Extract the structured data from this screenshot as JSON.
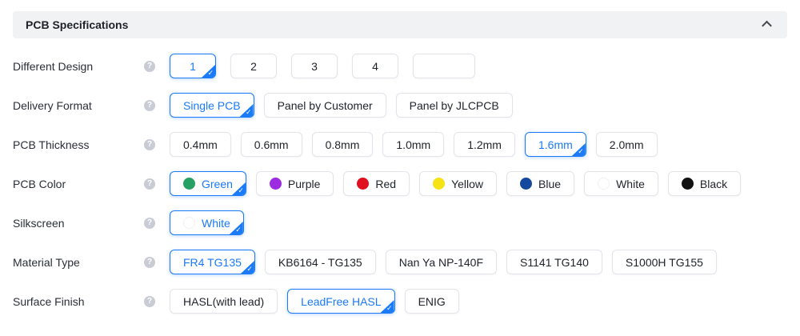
{
  "header": {
    "title": "PCB Specifications",
    "collapse_icon": "chevron-up"
  },
  "icons": {
    "help_glyph": "?",
    "check_glyph": "✓"
  },
  "colors": {
    "accent": "#1a7af8",
    "header_bg": "#f1f2f4",
    "button_border": "#e2e4e9",
    "text": "#1f2329",
    "help_icon_bg": "#c9ccd4"
  },
  "rows": [
    {
      "label": "Different Design",
      "variant": "number",
      "options": [
        {
          "label": "1",
          "selected": true
        },
        {
          "label": "2"
        },
        {
          "label": "3"
        },
        {
          "label": "4"
        }
      ],
      "custom_input": {
        "value": "",
        "placeholder": ""
      }
    },
    {
      "label": "Delivery Format",
      "options": [
        {
          "label": "Single PCB",
          "selected": true
        },
        {
          "label": "Panel by Customer"
        },
        {
          "label": "Panel by JLCPCB"
        }
      ]
    },
    {
      "label": "PCB Thickness",
      "options": [
        {
          "label": "0.4mm"
        },
        {
          "label": "0.6mm"
        },
        {
          "label": "0.8mm"
        },
        {
          "label": "1.0mm"
        },
        {
          "label": "1.2mm"
        },
        {
          "label": "1.6mm",
          "selected": true
        },
        {
          "label": "2.0mm"
        }
      ]
    },
    {
      "label": "PCB Color",
      "options": [
        {
          "label": "Green",
          "dot": "#27a163",
          "selected": true
        },
        {
          "label": "Purple",
          "dot": "#9d2be2"
        },
        {
          "label": "Red",
          "dot": "#e01020"
        },
        {
          "label": "Yellow",
          "dot": "#f5e316"
        },
        {
          "label": "Blue",
          "dot": "#15499e"
        },
        {
          "label": "White",
          "dot": "#ffffff"
        },
        {
          "label": "Black",
          "dot": "#121212"
        }
      ]
    },
    {
      "label": "Silkscreen",
      "options": [
        {
          "label": "White",
          "dot": "#ffffff",
          "selected": true
        }
      ]
    },
    {
      "label": "Material Type",
      "options": [
        {
          "label": "FR4 TG135",
          "selected": true
        },
        {
          "label": "KB6164 - TG135"
        },
        {
          "label": "Nan Ya NP-140F"
        },
        {
          "label": "S1141 TG140"
        },
        {
          "label": "S1000H TG155"
        }
      ]
    },
    {
      "label": "Surface Finish",
      "options": [
        {
          "label": "HASL(with lead)"
        },
        {
          "label": "LeadFree HASL",
          "selected": true
        },
        {
          "label": "ENIG"
        }
      ]
    }
  ]
}
